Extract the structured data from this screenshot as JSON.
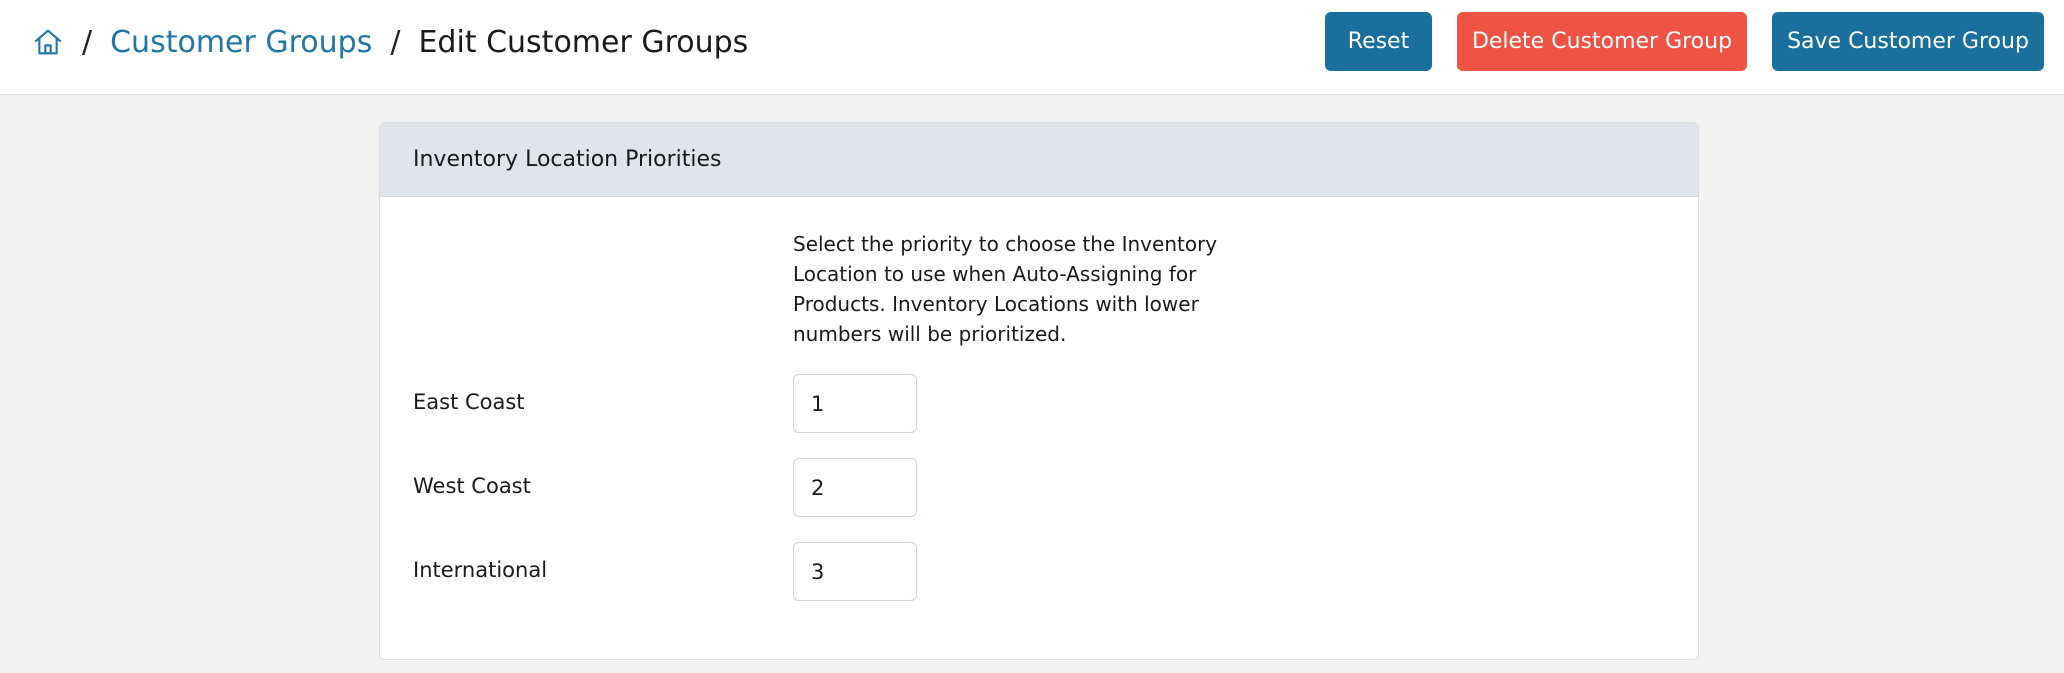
{
  "breadcrumb": {
    "home_icon": "home-icon",
    "separator": "/",
    "parent": "Customer Groups",
    "current": "Edit Customer Groups"
  },
  "toolbar": {
    "reset_label": "Reset",
    "delete_label": "Delete Customer Group",
    "save_label": "Save Customer Group"
  },
  "colors": {
    "primary": "#1b6f9c",
    "danger": "#ee5343",
    "link": "#1f77a8",
    "card_header_bg": "#e0e5ec",
    "page_bg": "#f2f2f2"
  },
  "card": {
    "title": "Inventory Location Priorities",
    "description": "Select the priority to choose the Inventory Location to use when Auto-Assigning for Products. Inventory Locations with lower numbers will be prioritized.",
    "locations": [
      {
        "label": "East Coast",
        "priority": "1"
      },
      {
        "label": "West Coast",
        "priority": "2"
      },
      {
        "label": "International",
        "priority": "3"
      }
    ]
  }
}
